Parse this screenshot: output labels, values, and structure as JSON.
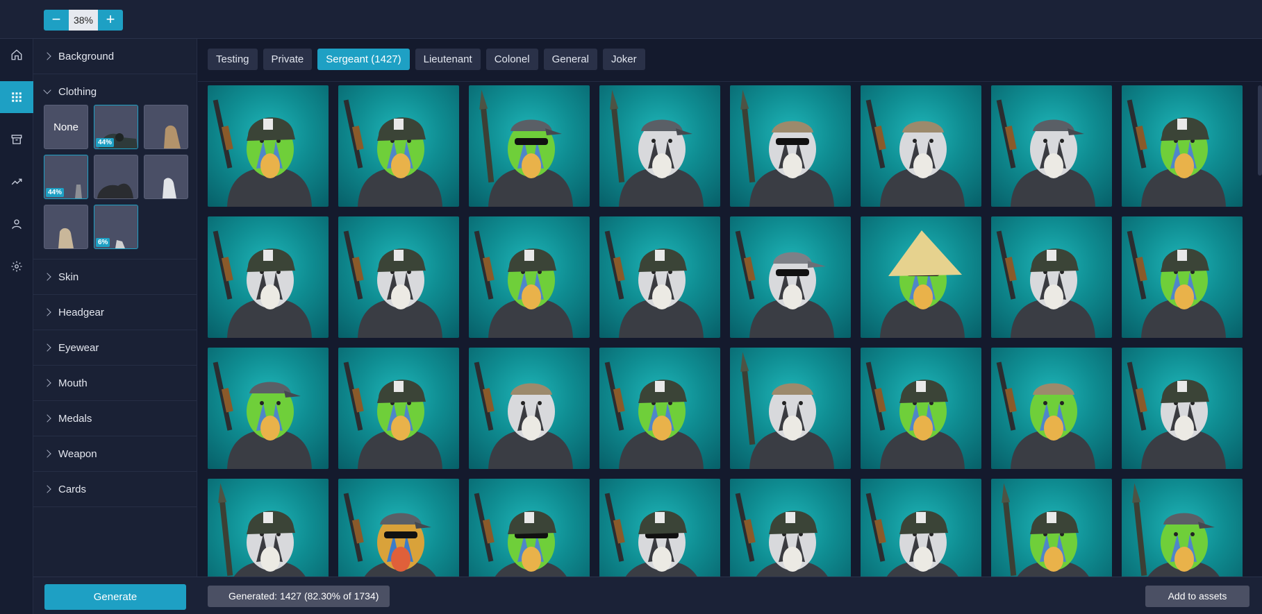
{
  "zoom": {
    "minus": "−",
    "value": "38%",
    "plus": "+"
  },
  "rail": [
    {
      "icon": "home-icon"
    },
    {
      "icon": "grid-icon",
      "active": true
    },
    {
      "icon": "archive-icon"
    },
    {
      "icon": "chart-icon"
    },
    {
      "icon": "user-icon"
    },
    {
      "icon": "gear-icon"
    }
  ],
  "sections": {
    "background": "Background",
    "clothing": "Clothing",
    "skin": "Skin",
    "headgear": "Headgear",
    "eyewear": "Eyewear",
    "mouth": "Mouth",
    "medals": "Medals",
    "weapon": "Weapon",
    "cards": "Cards"
  },
  "clothing_options": {
    "none_label": "None",
    "badge_1": "44%",
    "badge_2": "44%",
    "badge_3": "6%"
  },
  "tabs": [
    "Testing",
    "Private",
    "Sergeant (1427)",
    "Lieutenant",
    "Colonel",
    "General",
    "Joker"
  ],
  "active_tab": "Sergeant (1427)",
  "footer": {
    "generate": "Generate",
    "status": "Generated: 1427 (82.30% of 1734)",
    "add_to_assets": "Add to assets"
  },
  "grid": {
    "rows": 4,
    "cols": 8,
    "cards": [
      {
        "skin": "green",
        "hat": "helmet",
        "weapon": "rifle"
      },
      {
        "skin": "green",
        "hat": "helmet",
        "weapon": "rifle"
      },
      {
        "skin": "green",
        "hat": "cap",
        "weapon": "rocket",
        "glasses": true
      },
      {
        "skin": "zebra",
        "hat": "cap",
        "weapon": "rocket"
      },
      {
        "skin": "zebra",
        "hat": "bandana",
        "weapon": "rocket",
        "glasses": true
      },
      {
        "skin": "zebra",
        "hat": "bandana",
        "weapon": "rifle"
      },
      {
        "skin": "zebra",
        "hat": "cap",
        "weapon": "rifle"
      },
      {
        "skin": "green",
        "hat": "helmet",
        "weapon": "rifle"
      },
      {
        "skin": "zebra",
        "hat": "helmet",
        "weapon": "rifle"
      },
      {
        "skin": "zebra",
        "hat": "helmet",
        "weapon": "rifle"
      },
      {
        "skin": "green",
        "hat": "helmet",
        "weapon": "rifle"
      },
      {
        "skin": "zebra",
        "hat": "helmet",
        "weapon": "rifle"
      },
      {
        "skin": "zebra",
        "hat": "baseball",
        "weapon": "rifle",
        "glasses": true
      },
      {
        "skin": "green",
        "hat": "straw",
        "weapon": "none",
        "glasses": true
      },
      {
        "skin": "zebra",
        "hat": "helmet",
        "weapon": "rifle"
      },
      {
        "skin": "green",
        "hat": "helmet",
        "weapon": "rifle"
      },
      {
        "skin": "green",
        "hat": "cap",
        "weapon": "rifle"
      },
      {
        "skin": "green",
        "hat": "helmet",
        "weapon": "rifle"
      },
      {
        "skin": "zebra",
        "hat": "bandana",
        "weapon": "rifle"
      },
      {
        "skin": "green",
        "hat": "helmet",
        "weapon": "rifle"
      },
      {
        "skin": "zebra",
        "hat": "bandana",
        "weapon": "rocket"
      },
      {
        "skin": "green",
        "hat": "helmet",
        "weapon": "rifle"
      },
      {
        "skin": "green",
        "hat": "bandana",
        "weapon": "rifle"
      },
      {
        "skin": "zebra",
        "hat": "helmet",
        "weapon": "rifle"
      },
      {
        "skin": "zebra",
        "hat": "helmet",
        "weapon": "rocket"
      },
      {
        "skin": "colorful",
        "hat": "cap",
        "weapon": "rifle",
        "glasses": true
      },
      {
        "skin": "green",
        "hat": "helmet",
        "weapon": "rifle",
        "glasses": true
      },
      {
        "skin": "zebra",
        "hat": "helmet",
        "weapon": "rifle",
        "glasses": true
      },
      {
        "skin": "zebra",
        "hat": "helmet",
        "weapon": "rifle"
      },
      {
        "skin": "zebra",
        "hat": "helmet",
        "weapon": "rifle"
      },
      {
        "skin": "green",
        "hat": "helmet",
        "weapon": "rocket"
      },
      {
        "skin": "green",
        "hat": "cap",
        "weapon": "rocket"
      }
    ]
  }
}
